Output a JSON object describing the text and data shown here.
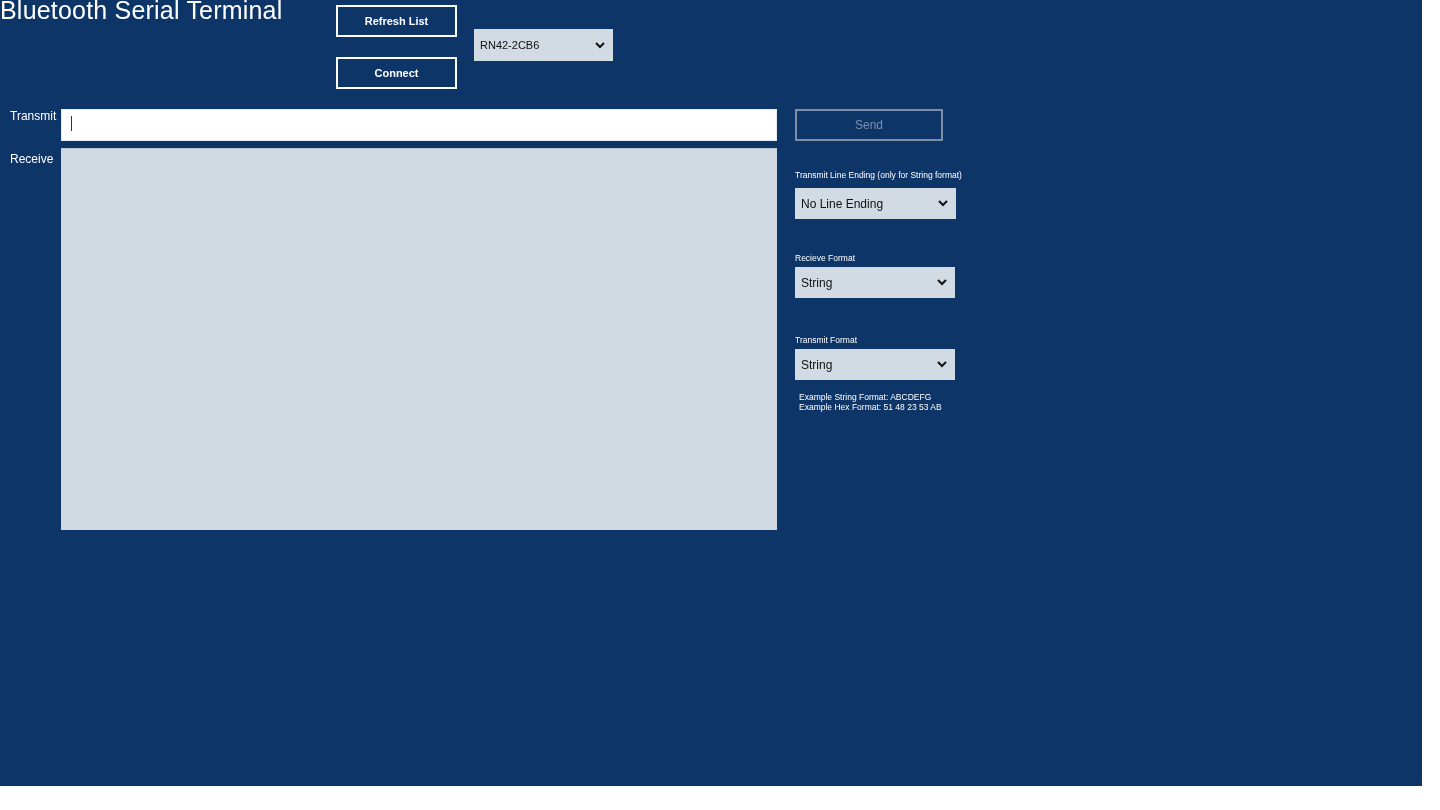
{
  "window": {
    "title": "Bluetooth Serial Terminal"
  },
  "toolbar": {
    "buttons": [
      {
        "label": "Refresh List",
        "disabled": false
      },
      {
        "label": "Connect",
        "disabled": false
      }
    ],
    "device_dropdown": {
      "value": "RN42-2CB6"
    }
  },
  "transmit": {
    "label": "Transmit",
    "focused": true
  },
  "receive": {
    "label": "Receive"
  },
  "send_button": {
    "label": "Send",
    "disabled": true
  },
  "settings": [
    {
      "label": "Transmit Line Ending (only for String format)",
      "value": "No Line Ending"
    },
    {
      "label": "Recieve Format",
      "value": "String"
    },
    {
      "label": "Transmit Format",
      "value": "String"
    }
  ],
  "examples": [
    "Example String Format: ABCDEFG",
    "Example Hex Format: 51 48 23 53 AB"
  ]
}
